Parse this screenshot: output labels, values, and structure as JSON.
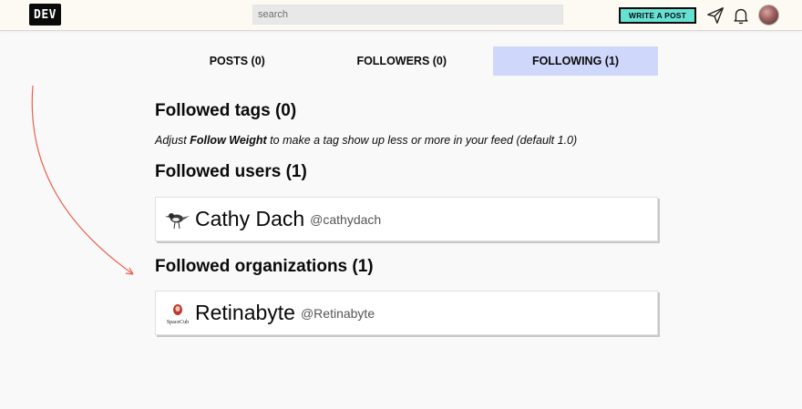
{
  "header": {
    "logo_text": "DEV",
    "search_placeholder": "search",
    "write_post_label": "WRITE A POST",
    "accent_color": "#66e2d5"
  },
  "tabs": [
    {
      "label": "POSTS (0)",
      "active": false
    },
    {
      "label": "FOLLOWERS (0)",
      "active": false
    },
    {
      "label": "FOLLOWING (1)",
      "active": true
    }
  ],
  "sections": {
    "tags": {
      "title": "Followed tags (0)",
      "hint_prefix": "Adjust ",
      "hint_bold": "Follow Weight",
      "hint_suffix": " to make a tag show up less or more in your feed (default 1.0)"
    },
    "users": {
      "title": "Followed users (1)",
      "items": [
        {
          "name": "Cathy Dach",
          "handle": "@cathydach",
          "icon": "bird-avatar-icon"
        }
      ]
    },
    "organizations": {
      "title": "Followed organizations (1)",
      "items": [
        {
          "name": "Retinabyte",
          "handle": "@Retinabyte",
          "logo_text": "SpaceCub",
          "icon": "org-logo-icon"
        }
      ]
    }
  },
  "annotation": {
    "color": "#e8604c",
    "icon": "curved-arrow"
  }
}
